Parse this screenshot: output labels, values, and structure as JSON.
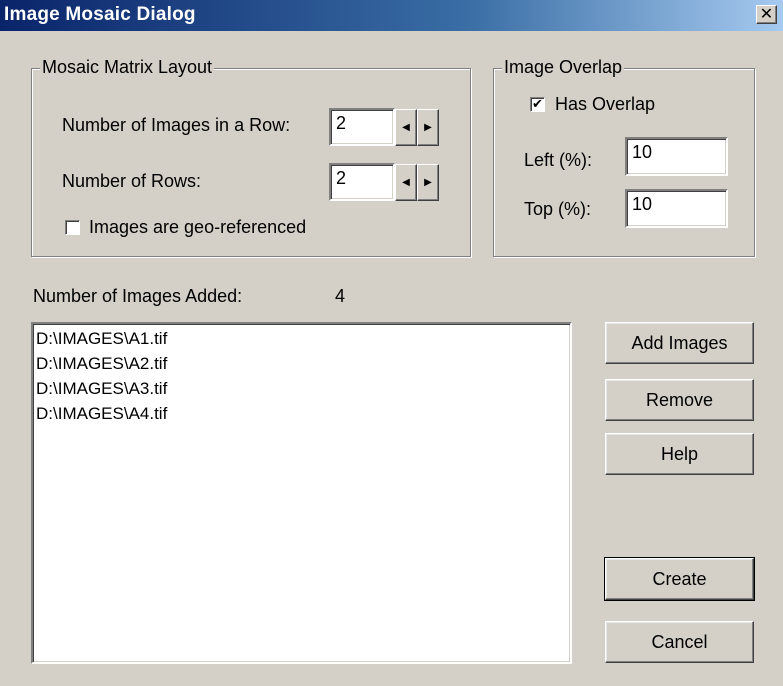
{
  "window": {
    "title": "Image Mosaic Dialog",
    "close_glyph": "✕"
  },
  "mosaic_layout": {
    "legend": "Mosaic Matrix Layout",
    "images_per_row_label": "Number of Images in a Row:",
    "images_per_row_value": "2",
    "rows_label": "Number of Rows:",
    "rows_value": "2",
    "geo_referenced_label": "Images are geo-referenced",
    "geo_referenced_checked": false,
    "spin_left_glyph": "◀",
    "spin_right_glyph": "▶"
  },
  "image_overlap": {
    "legend": "Image Overlap",
    "has_overlap_label": "Has Overlap",
    "has_overlap_checked": true,
    "check_glyph": "✔",
    "left_label": "Left (%):",
    "left_value": "10",
    "top_label": "Top (%):",
    "top_value": "10"
  },
  "images_added": {
    "label": "Number of Images Added:",
    "count": "4"
  },
  "image_list": [
    "D:\\IMAGES\\A1.tif",
    "D:\\IMAGES\\A2.tif",
    "D:\\IMAGES\\A3.tif",
    "D:\\IMAGES\\A4.tif"
  ],
  "buttons": {
    "add_images": "Add Images",
    "remove": "Remove",
    "help": "Help",
    "create": "Create",
    "cancel": "Cancel"
  },
  "colors": {
    "dialog_face": "#d4d0c8",
    "titlebar_start": "#0a246a",
    "titlebar_end": "#a6caf0",
    "title_text": "#ffffff"
  }
}
